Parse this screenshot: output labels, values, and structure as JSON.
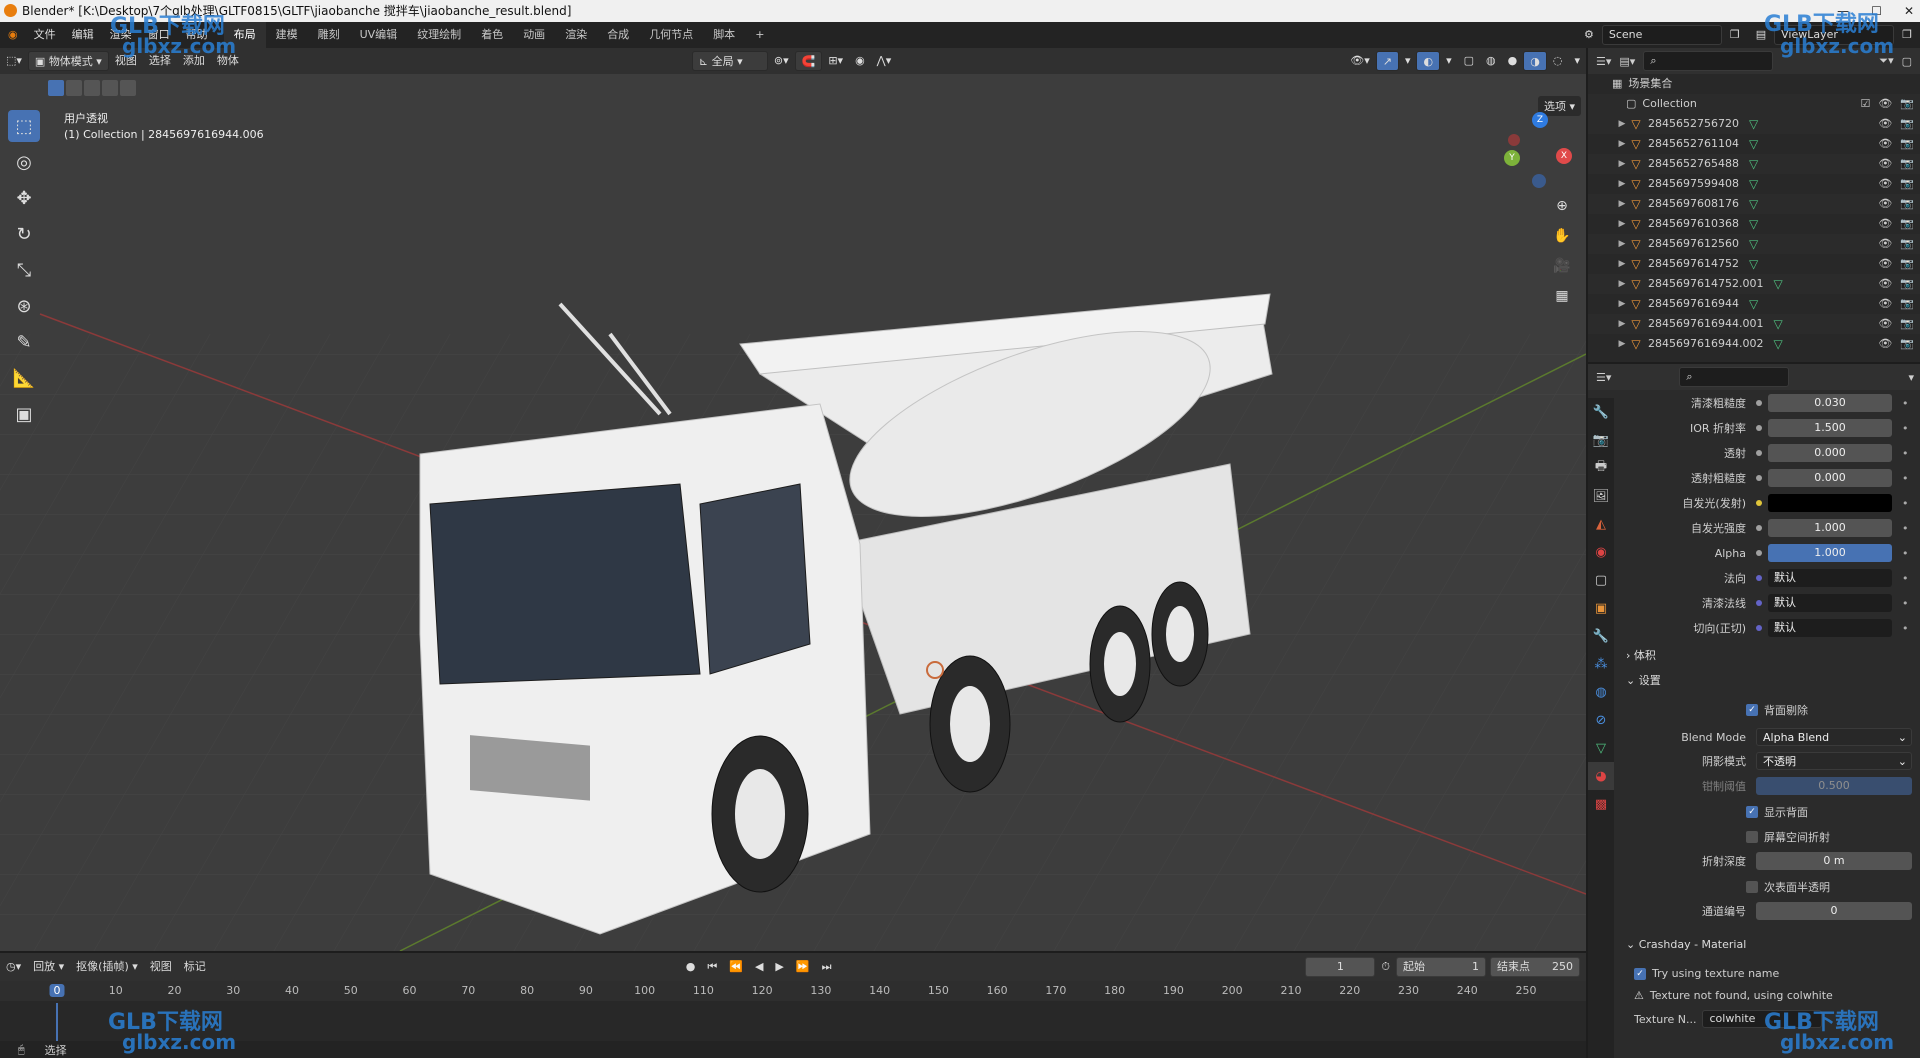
{
  "title_bar": {
    "text": "Blender* [K:\\Desktop\\7个glb处理\\GLTF0815\\GLTF\\jiaobanche 搅拌车\\jiaobanche_result.blend]"
  },
  "menu": [
    "文件",
    "编辑",
    "渲染",
    "窗口",
    "帮助"
  ],
  "workspaces": [
    "布局",
    "建模",
    "雕刻",
    "UV编辑",
    "纹理绘制",
    "着色",
    "动画",
    "渲染",
    "合成",
    "几何节点",
    "脚本"
  ],
  "active_workspace": "布局",
  "add_tab": "+",
  "scene": {
    "name": "Scene",
    "view_layer": "ViewLayer"
  },
  "viewport_header": {
    "mode": "物体模式",
    "menus": [
      "视图",
      "选择",
      "添加",
      "物体"
    ],
    "transform": "全局",
    "options": "选项"
  },
  "viewport": {
    "view_name": "用户透视",
    "collection_info": "(1) Collection | 2845697616944.006"
  },
  "gizmo": {
    "z": "Z",
    "x": "X",
    "y": "Y"
  },
  "outliner": {
    "title": "场景集合",
    "collection": "Collection",
    "items": [
      "2845652756720",
      "2845652761104",
      "2845652765488",
      "2845697599408",
      "2845697608176",
      "2845697610368",
      "2845697612560",
      "2845697614752",
      "2845697614752.001",
      "2845697616944",
      "2845697616944.001",
      "2845697616944.002"
    ]
  },
  "properties": {
    "rows": [
      {
        "label": "清漆粗糙度",
        "value": "0.030",
        "kind": "num"
      },
      {
        "label": "IOR 折射率",
        "value": "1.500",
        "kind": "num"
      },
      {
        "label": "透射",
        "value": "0.000",
        "kind": "num"
      },
      {
        "label": "透射粗糙度",
        "value": "0.000",
        "kind": "num"
      },
      {
        "label": "自发光(发射)",
        "value": "",
        "kind": "black"
      },
      {
        "label": "自发光强度",
        "value": "1.000",
        "kind": "num"
      },
      {
        "label": "Alpha",
        "value": "1.000",
        "kind": "sel"
      },
      {
        "label": "法向",
        "value": "默认",
        "kind": "link"
      },
      {
        "label": "清漆法线",
        "value": "默认",
        "kind": "link"
      },
      {
        "label": "切向(正切)",
        "value": "默认",
        "kind": "link"
      }
    ],
    "panel_volume": "体积",
    "panel_settings": "设置",
    "backface_culling": "背面剔除",
    "blend_mode_label": "Blend Mode",
    "blend_mode": "Alpha Blend",
    "shadow_mode_label": "阴影模式",
    "shadow_mode": "不透明",
    "clip_threshold_label": "钳制阈值",
    "clip_threshold": "0.500",
    "show_backface": "显示背面",
    "screen_refraction": "屏幕空间折射",
    "refraction_depth_label": "折射深度",
    "refraction_depth": "0 m",
    "subsurface_translucency": "次表面半透明",
    "pass_index_label": "通道编号",
    "pass_index": "0",
    "crashday_panel": "Crashday - Material",
    "try_texture_name": "Try using texture name",
    "warning": "Texture not found, using colwhite",
    "texture_label": "Texture N...",
    "texture_value": "colwhite"
  },
  "timeline": {
    "menus": [
      "回放",
      "抠像(插帧)",
      "视图",
      "标记"
    ],
    "current_frame": "1",
    "start_label": "起始",
    "start": "1",
    "end_label": "结束点",
    "end": "250",
    "ticks": [
      "0",
      "10",
      "20",
      "30",
      "40",
      "50",
      "60",
      "70",
      "80",
      "90",
      "100",
      "110",
      "120",
      "130",
      "140",
      "150",
      "160",
      "170",
      "180",
      "190",
      "200",
      "210",
      "220",
      "230",
      "240",
      "250"
    ]
  },
  "status": {
    "left": "选择"
  },
  "watermarks": [
    "GLB下载网",
    "glbxz.com"
  ]
}
